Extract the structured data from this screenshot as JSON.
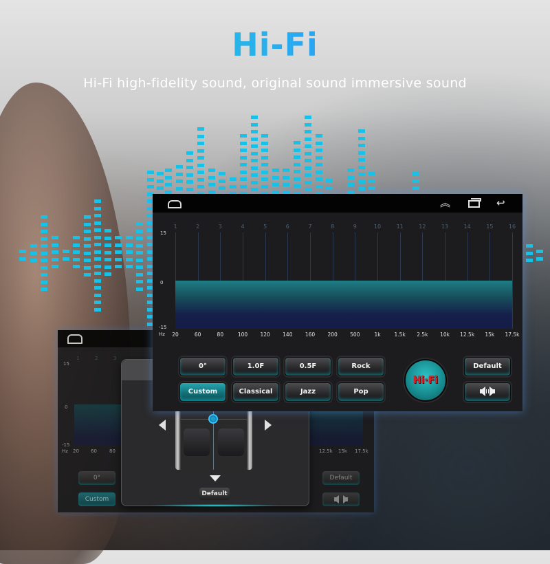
{
  "hero": {
    "title": "Hi-Fi",
    "subtitle": "Hi-Fi high-fidelity sound, original sound immersive sound",
    "title_gradient": [
      "#1de0d0",
      "#1a6ef2"
    ],
    "visualizer_color": "#18c2e6"
  },
  "navbar": {
    "icons": [
      "home-icon",
      "chevrons-up-icon",
      "recent-apps-icon",
      "back-icon"
    ],
    "chevrons_glyph": "︽",
    "back_glyph": "↩"
  },
  "equalizer": {
    "band_numbers": [
      "1",
      "2",
      "3",
      "4",
      "5",
      "6",
      "7",
      "8",
      "9",
      "10",
      "11",
      "12",
      "13",
      "14",
      "15",
      "16"
    ],
    "y_axis": {
      "max_label": "15",
      "mid_label": "0",
      "min_label": "-15",
      "unit": "Hz"
    },
    "frequencies": [
      "20",
      "60",
      "80",
      "100",
      "120",
      "140",
      "160",
      "200",
      "500",
      "1k",
      "1.5k",
      "2.5k",
      "10k",
      "12.5k",
      "15k",
      "17.5k"
    ],
    "band_gains_db": [
      0,
      0,
      0,
      0,
      0,
      0,
      0,
      0,
      0,
      0,
      0,
      0,
      0,
      0,
      0,
      0
    ],
    "range_db": [
      -15,
      15
    ],
    "fill_color_top": "#1e7d86",
    "fill_color_bottom": "#141c48"
  },
  "presets": {
    "row1": [
      "0°",
      "1.0F",
      "0.5F",
      "Rock"
    ],
    "row2": [
      "Custom",
      "Classical",
      "Jazz",
      "Pop"
    ],
    "active": "Custom",
    "accent": "#1a8e96"
  },
  "hifi_badge": {
    "label": "Hi·Fi",
    "color": "#e1202a"
  },
  "side_buttons": {
    "default_label": "Default",
    "speaker_icon": "speaker-balance-icon"
  },
  "balance_dialog": {
    "default_label": "Default"
  },
  "back_panel": {
    "ytick_max": "15",
    "ytick_mid": "0",
    "ytick_min": "-15",
    "unit": "Hz",
    "freq_left": [
      "20",
      "60",
      "80"
    ],
    "freq_right": [
      "12.5k",
      "15k",
      "17.5k"
    ],
    "band_numbers": [
      "1",
      "2",
      "3"
    ],
    "btn_0": "0°",
    "btn_custom": "Custom",
    "btn_default": "Default"
  }
}
